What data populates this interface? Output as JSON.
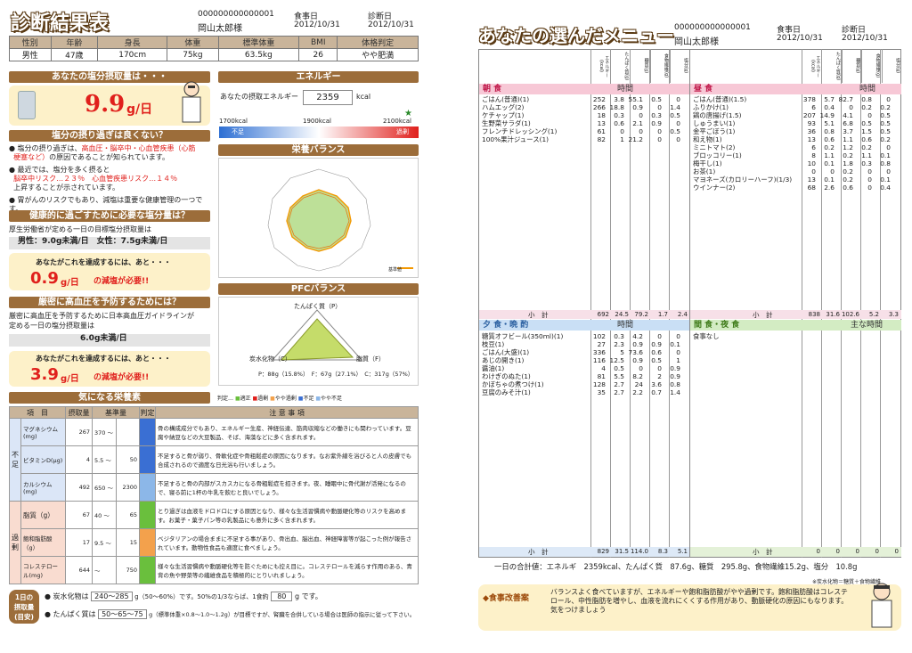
{
  "left": {
    "title": "診断結果表",
    "id": "000000000000001",
    "name": "岡山太郎様",
    "meal_date_label": "食事日",
    "meal_date": "2012/10/31",
    "diag_date_label": "診断日",
    "diag_date": "2012/10/31",
    "profile_headers": [
      "性別",
      "年齢",
      "身長",
      "体重",
      "標準体重",
      "BMI",
      "体格判定"
    ],
    "profile_values": [
      "男性",
      "47歳",
      "170cm",
      "75kg",
      "63.5kg",
      "26",
      "やや肥満"
    ],
    "salt": {
      "title": "あなたの塩分摂取量は・・・",
      "value": "9.9",
      "unit": "g/日"
    },
    "salt_danger": {
      "title": "塩分の摂り過ぎは良くない？",
      "p1a": "塩分の摂り過ぎは、",
      "p1b": "高血圧・脳卒中・心血管疾患（心筋",
      "p1c": "梗塞など）",
      "p1d": "の原因であることが知られています。",
      "p2a": "最近では、塩分を多く摂ると",
      "p2b": "脳卒中リスク…２３％　心血管疾患リスク…１４％",
      "p2c": "上昇することが示されています。",
      "p3": "胃がんのリスクでもあり、減塩は重要な健康管理の一つです。"
    },
    "healthy": {
      "title": "健康的に過ごすために必要な塩分量は？",
      "text": "厚生労働省が定める一日の目標塩分摂取量は",
      "target": "男性：9.0g未満/日　女性：7.5g未満/日",
      "achieve": "あなたがこれを達成するには、あと・・・",
      "value": "0.9",
      "unit": "g/日",
      "suffix": "の減塩が必要!!"
    },
    "bp": {
      "title": "厳密に高血圧を予防するためには？",
      "text1": "厳密に高血圧を予防するために日本高血圧ガイドラインが",
      "text2": "定める一日の塩分摂取量は",
      "target": "6.0g未満/日",
      "achieve": "あなたがこれを達成するには、あと・・・",
      "value": "3.9",
      "unit": "g/日",
      "suffix": "の減塩が必要!!"
    },
    "energy": {
      "title": "エネルギー",
      "label": "あなたの摂取エネルギー",
      "value": "2359",
      "unit": "kcal",
      "low": "1700kcal",
      "mid": "1900kcal",
      "high": "2100kcal",
      "under": "不足",
      "over": "過剰"
    },
    "balance": {
      "title": "栄養バランス",
      "legend": "基準値"
    },
    "pfc": {
      "title": "PFCバランス",
      "protein_label": "たんぱく質（P）",
      "fat_label": "脂質（F）",
      "carb_label": "炭水化物（C）",
      "values": "P：88g（15.8%）　F：67g（27.1%）　C：317g（57%）"
    },
    "watch": {
      "title": "気になる栄養素",
      "judge_label": "判定…",
      "legend": [
        "適正",
        "過剰",
        "やや過剰",
        "不足",
        "やや不足"
      ],
      "headers": [
        "項　目",
        "摂取量",
        "基準量",
        "判定",
        "注 意 事 項"
      ],
      "group_short": "不足",
      "group_over": "過剰",
      "rows": [
        {
          "name": "マグネシウム(mg)",
          "intake": "267",
          "min": "370",
          "max": "",
          "note": "骨の構成成分でもあり、エネルギー生産、神経伝達、筋肉収縮などの働きにも関わっています。豆腐や納豆などの大豆製品、そば、海藻などに多く含まれます。"
        },
        {
          "name": "ビタミンD(μg)",
          "intake": "4",
          "min": "5.5",
          "max": "50",
          "note": "不足すると骨が弱り、骨軟化症や骨粗鬆症の原因になります。なお紫外線を浴びると人の皮膚でも合成されるので適度な日光浴も行いましょう。"
        },
        {
          "name": "カルシウム(mg)",
          "intake": "492",
          "min": "650",
          "max": "2300",
          "note": "不足すると骨の内部がスカスカになる骨粗鬆症を招きます。夜、睡眠中に骨代謝が活発になるので、寝る前に1杯の牛乳を飲むと良いでしょう。"
        },
        {
          "name": "脂質（g）",
          "intake": "67",
          "min": "40",
          "max": "65",
          "note": "とり過ぎは血液をドロドロにする原因となり、様々な生活習慣病や動脈硬化等のリスクを高めます。お菓子・菓子パン等の乳製品にも意外に多く含まれます。"
        },
        {
          "name": "飽和脂肪酸（g）",
          "intake": "17",
          "min": "9.5",
          "max": "15",
          "note": "ベジタリアンの場合ままに不足する事があり、骨出血、脳出血、神経障害等が起こった例が報告されています。動物性食品も適度に食べましょう。"
        },
        {
          "name": "コレステロール(mg)",
          "intake": "644",
          "min": "",
          "max": "750",
          "note": "様々な生活習慣病や動脈硬化等を防ぐためにも控え目に。コレステロールを減らす作用のある、青背の魚や野菜等の繊維食品を積極的にとりいれましょう。"
        }
      ]
    },
    "daily": {
      "badge1": "1日の",
      "badge2": "摂取量",
      "badge3": "(目安)",
      "carb_label": "炭水化物は",
      "carb_range": "240〜285",
      "carb_note": "g（50〜60%）です。50%の1/3ならば、1食約",
      "carb_meal": "80",
      "carb_end": "g です。",
      "prot_label": "たんぱく質は",
      "prot_range": "50〜65〜75",
      "prot_note": "g（標準体重×0.8〜1.0〜1.2g）が目標ですが、腎臓を合併している場合は医師の指示に従って下さい。"
    }
  },
  "right": {
    "title": "あなたの選んだメニュー",
    "id": "000000000000001",
    "name": "岡山太郎様",
    "meal_date_label": "食事日",
    "meal_date": "2012/10/31",
    "diag_date_label": "診断日",
    "diag_date": "2012/10/31",
    "col_headers": [
      "エネルギー(kcal)",
      "たんぱく質(g)",
      "糖質(g)",
      "食物繊維(g)",
      "塩分(g)"
    ],
    "time_label": "時間",
    "breakfast": {
      "title": "朝 食",
      "items": [
        [
          "ごはん(普通)(1)",
          "252",
          "3.8",
          "55.1",
          "0.5",
          "0"
        ],
        [
          "ハムエッグ(2)",
          "266",
          "18.8",
          "0.9",
          "0",
          "1.4"
        ],
        [
          "ケチャップ(1)",
          "18",
          "0.3",
          "0",
          "0.3",
          "0.5"
        ],
        [
          "生野菜サラダ(1)",
          "13",
          "0.6",
          "2.1",
          "0.9",
          "0"
        ],
        [
          "フレンチドレッシング(1)",
          "61",
          "0",
          "0",
          "0",
          "0.5"
        ],
        [
          "100%果汁ジュース(1)",
          "82",
          "1",
          "21.2",
          "0",
          "0"
        ]
      ],
      "subtotal_label": "小　計",
      "subtotal": [
        "692",
        "24.5",
        "79.2",
        "1.7",
        "2.4"
      ]
    },
    "lunch": {
      "title": "昼 食",
      "items": [
        [
          "ごはん(普通)(1.5)",
          "378",
          "5.7",
          "82.7",
          "0.8",
          "0"
        ],
        [
          "ふりかけ(1)",
          "6",
          "0.4",
          "0",
          "0.2",
          "0.2"
        ],
        [
          "鶏の唐揚げ(1.5)",
          "207",
          "14.9",
          "4.1",
          "0",
          "0.5"
        ],
        [
          "しゅうまい(1)",
          "93",
          "5.1",
          "6.8",
          "0.5",
          "0.5"
        ],
        [
          "金平ごぼう(1)",
          "36",
          "0.8",
          "3.7",
          "1.5",
          "0.5"
        ],
        [
          "和え物(1)",
          "13",
          "0.6",
          "1.1",
          "0.6",
          "0.2"
        ],
        [
          "ミニトマト(2)",
          "6",
          "0.2",
          "1.2",
          "0.2",
          "0"
        ],
        [
          "ブロッコリー(1)",
          "8",
          "1.1",
          "0.2",
          "1.1",
          "0.1"
        ],
        [
          "梅干し(1)",
          "10",
          "0.1",
          "1.8",
          "0.3",
          "0.8"
        ],
        [
          "お茶(1)",
          "0",
          "0",
          "0.2",
          "0",
          "0"
        ],
        [
          "マヨネーズ(カロリーハーフ)(1/3)",
          "13",
          "0.1",
          "0.2",
          "0",
          "0.1"
        ],
        [
          "ウインナー(2)",
          "68",
          "2.6",
          "0.6",
          "0",
          "0.4"
        ]
      ],
      "subtotal_label": "小　計",
      "subtotal": [
        "838",
        "31.6",
        "102.6",
        "5.2",
        "3.3"
      ]
    },
    "dinner": {
      "title": "夕 食・晩 酌",
      "items": [
        [
          "糖質オフビール(350ml)(1)",
          "102",
          "0.3",
          "4.2",
          "0",
          "0"
        ],
        [
          "枝豆(1)",
          "27",
          "2.3",
          "0.9",
          "0.9",
          "0.1"
        ],
        [
          "ごはん(大盛)(1)",
          "336",
          "5",
          "73.6",
          "0.6",
          "0"
        ],
        [
          "あじの開き(1)",
          "116",
          "12.5",
          "0.9",
          "0.5",
          "1"
        ],
        [
          "醤油(1)",
          "4",
          "0.5",
          "0",
          "0",
          "0.9"
        ],
        [
          "わけぎのぬた(1)",
          "81",
          "5.5",
          "8.2",
          "2",
          "0.9"
        ],
        [
          "かぼちゃの煮つけ(1)",
          "128",
          "2.7",
          "24",
          "3.6",
          "0.8"
        ],
        [
          "豆腐のみそ汁(1)",
          "35",
          "2.7",
          "2.2",
          "0.7",
          "1.4"
        ]
      ],
      "subtotal_label": "小　計",
      "subtotal": [
        "829",
        "31.5",
        "114.0",
        "8.3",
        "5.1"
      ]
    },
    "snack": {
      "title": "間 食・夜 食",
      "time_label": "主な時間",
      "items": [
        [
          "食事なし",
          "",
          "",
          "",
          "",
          ""
        ]
      ],
      "subtotal_label": "小　計",
      "subtotal": [
        "0",
        "0",
        "0",
        "0",
        "0"
      ]
    },
    "total": "一日の合計値：エネルギ　2359kcal、たんぱく質　87.6g、糖質　295.8g、食物繊維15.2g、塩分　10.8g",
    "footnote": "※炭水化物＝糖質＋食物繊維",
    "advice": {
      "title": "◆食事改善案",
      "text": "バランスよく食べていますが、エネルギーや飽和脂肪酸がやや過剰です。飽和脂肪酸はコレステロール、中性脂肪を増やし、血液を流れにくくする作用があり、動脈硬化の原因にもなります。気をつけましょう"
    }
  }
}
